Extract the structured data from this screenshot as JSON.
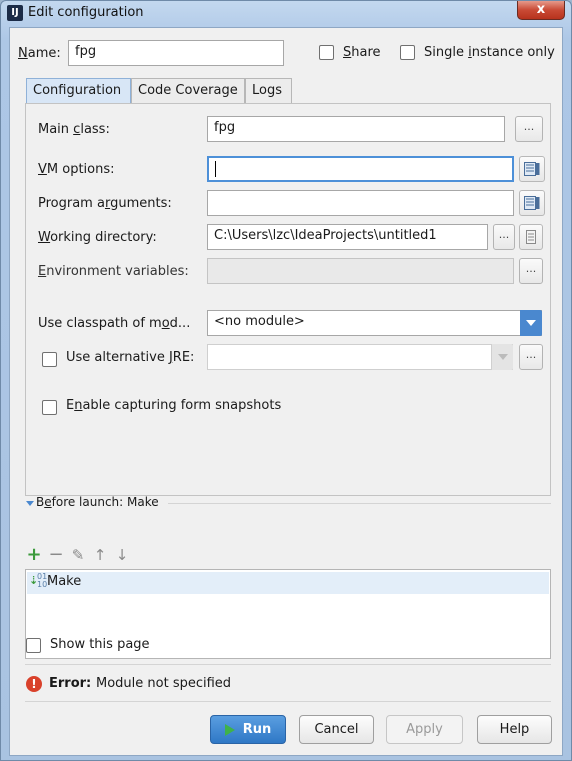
{
  "window": {
    "title": "Edit configuration",
    "close_glyph": "x",
    "app_icon": "intellij-icon"
  },
  "header": {
    "name_label": "Name:",
    "name_value": "fpg",
    "share_label": "Share",
    "share_checked": false,
    "single_instance_label": "Single instance only",
    "single_instance_checked": false
  },
  "tabs": [
    {
      "label": "Configuration",
      "active": true
    },
    {
      "label": "Code Coverage",
      "active": false
    },
    {
      "label": "Logs",
      "active": false
    }
  ],
  "form": {
    "main_class": {
      "label": "Main class:",
      "value": "fpg"
    },
    "vm_options": {
      "label": "VM options:",
      "value": ""
    },
    "program_arguments": {
      "label": "Program arguments:",
      "value": ""
    },
    "working_directory": {
      "label": "Working directory:",
      "value": "C:\\Users\\lzc\\IdeaProjects\\untitled1"
    },
    "environment_variables": {
      "label": "Environment variables:",
      "value": ""
    },
    "classpath_module": {
      "label": "Use classpath of mod...",
      "value": "<no module>"
    },
    "alternative_jre": {
      "label": "Use alternative JRE:",
      "checked": false,
      "value": ""
    },
    "form_snapshots": {
      "label": "Enable capturing form snapshots",
      "checked": false
    }
  },
  "browse_label": "...",
  "before_launch": {
    "title": "Before launch: Make",
    "toolbar_icons": [
      "add-icon",
      "remove-icon",
      "edit-icon",
      "move-up-icon",
      "move-down-icon"
    ],
    "items": [
      {
        "label": "Make",
        "icon": "make-icon"
      }
    ],
    "show_page_label": "Show this page",
    "show_page_checked": false
  },
  "error": {
    "prefix": "Error:",
    "message": "Module not specified",
    "icon": "error-icon",
    "color": "#d9412b"
  },
  "buttons": {
    "run": "Run",
    "cancel": "Cancel",
    "apply": "Apply",
    "help": "Help"
  },
  "colors": {
    "accent": "#4a88cf",
    "run_icon": "#3fb24a",
    "add_icon": "#3c9a3c"
  }
}
